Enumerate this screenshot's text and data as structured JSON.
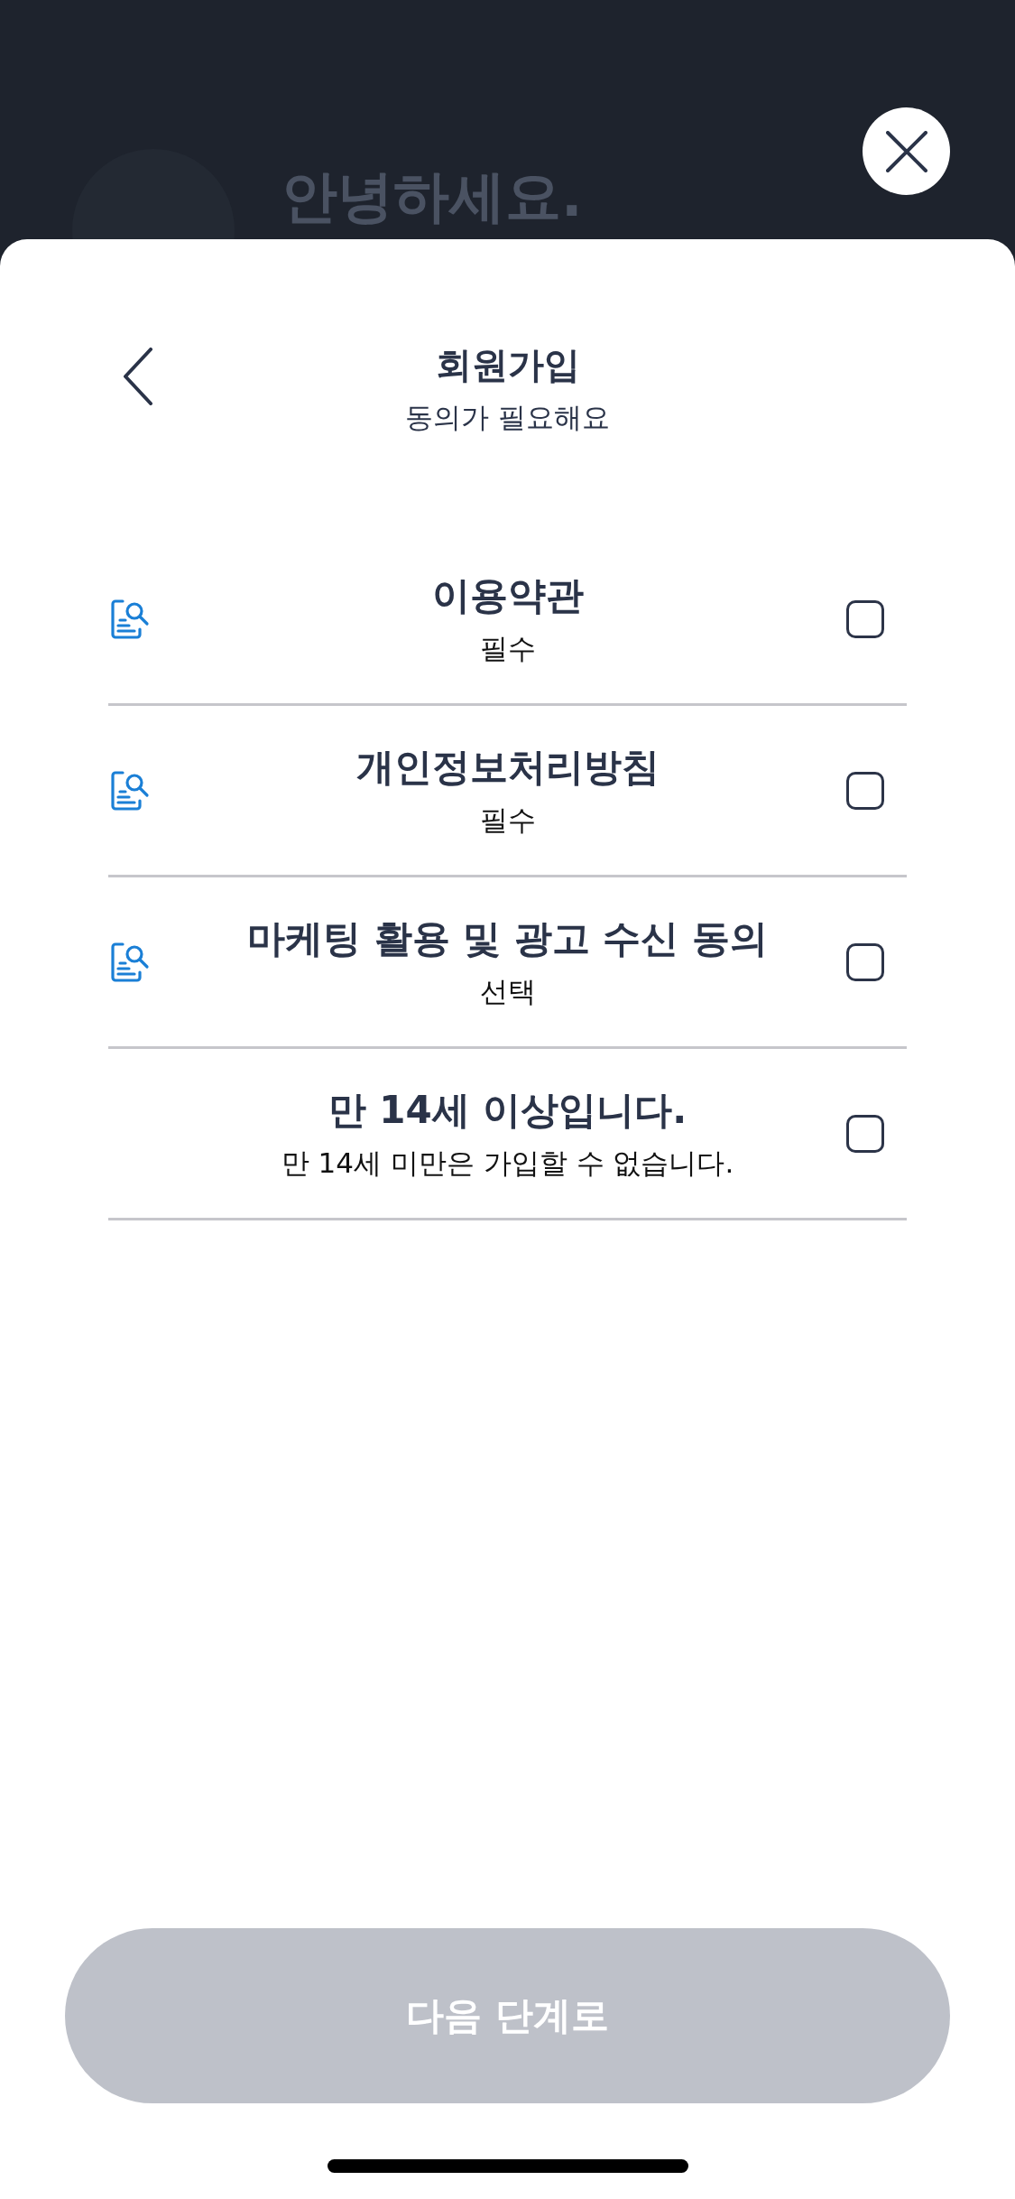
{
  "background": {
    "greeting": "안녕하세요."
  },
  "header": {
    "title": "회원가입",
    "subtitle": "동의가 필요해요"
  },
  "agreements": [
    {
      "kind": "document",
      "title": "이용약관",
      "note": "필수",
      "checked": false
    },
    {
      "kind": "document",
      "title": "개인정보처리방침",
      "note": "필수",
      "checked": false
    },
    {
      "kind": "document",
      "title": "마케팅 활용 및 광고 수신 동의",
      "note": "선택",
      "checked": false
    },
    {
      "kind": "plain",
      "title": "만 14세 이상입니다.",
      "note": "만 14세 미만은 가입할 수 없습니다.",
      "checked": false
    }
  ],
  "next_button": {
    "label": "다음 단계로",
    "disabled": true
  }
}
